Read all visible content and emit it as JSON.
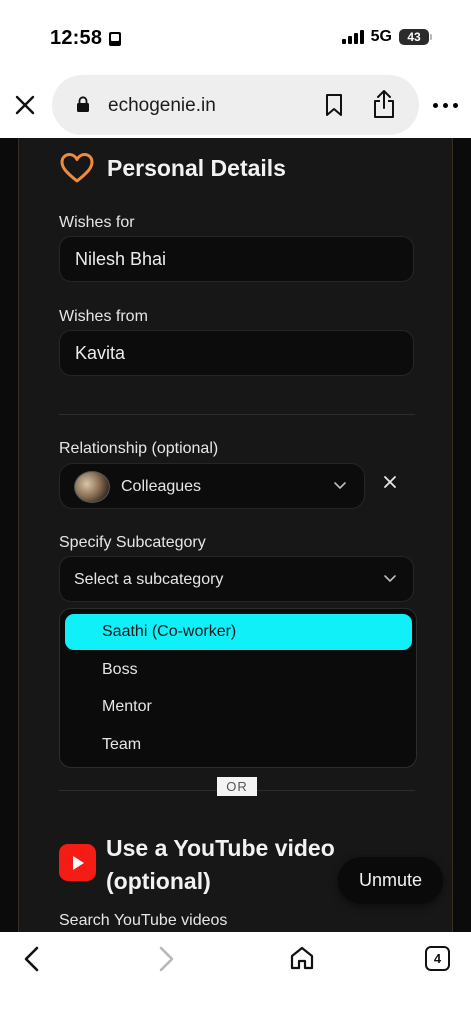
{
  "status_bar": {
    "time": "12:58",
    "network": "5G",
    "battery": "43"
  },
  "browser": {
    "url": "echogenie.in",
    "close_icon": "close-icon",
    "lock_icon": "lock-icon",
    "bookmark_icon": "bookmark-icon",
    "share_icon": "share-icon",
    "more_icon": "more-icon"
  },
  "form": {
    "section_title": "Personal Details",
    "section_icon": "heart-icon",
    "wishes_for": {
      "label": "Wishes for",
      "value": "Nilesh Bhai"
    },
    "wishes_from": {
      "label": "Wishes from",
      "value": "Kavita"
    },
    "relationship": {
      "label": "Relationship (optional)",
      "value": "Colleagues"
    },
    "subcategory": {
      "label": "Specify Subcategory",
      "placeholder": "Select a subcategory",
      "options": [
        "Saathi (Co-worker)",
        "Boss",
        "Mentor",
        "Team"
      ],
      "highlighted": "Saathi (Co-worker)"
    },
    "or_text": "OR",
    "youtube": {
      "title": "Use a YouTube video (optional)",
      "search_label": "Search YouTube videos"
    },
    "unmute_label": "Unmute"
  },
  "bottom_nav": {
    "tab_count": "4"
  },
  "colors": {
    "accent_orange": "#f08a3c",
    "highlight_cyan": "#10f0f8",
    "youtube_red": "#f41c14"
  }
}
